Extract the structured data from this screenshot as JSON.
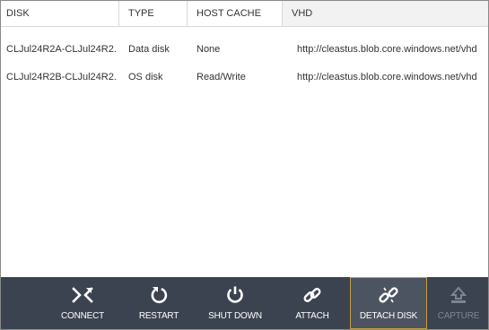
{
  "table": {
    "columns": [
      "DISK",
      "TYPE",
      "HOST CACHE",
      "VHD"
    ],
    "rows": [
      {
        "disk": "CLJul24R2A-CLJul24R2...",
        "type": "Data disk",
        "host_cache": "None",
        "vhd": "http://cleastus.blob.core.windows.net/vhd"
      },
      {
        "disk": "CLJul24R2B-CLJul24R2...",
        "type": "OS disk",
        "host_cache": "Read/Write",
        "vhd": "http://cleastus.blob.core.windows.net/vhd"
      }
    ]
  },
  "toolbar": {
    "connect": {
      "label": "CONNECT",
      "icon": "connect-icon"
    },
    "restart": {
      "label": "RESTART",
      "icon": "restart-icon"
    },
    "shutdown": {
      "label": "SHUT DOWN",
      "icon": "power-icon"
    },
    "attach": {
      "label": "ATTACH",
      "icon": "link-icon"
    },
    "detach": {
      "label": "DETACH DISK",
      "icon": "unlink-icon"
    },
    "capture": {
      "label": "CAPTURE",
      "icon": "capture-icon",
      "disabled": true
    }
  },
  "colors": {
    "toolbar_bg": "#3b4350",
    "selected_button_bg": "#4d5461",
    "selected_button_border": "#c59c3e",
    "disabled_text": "#7f8590"
  }
}
